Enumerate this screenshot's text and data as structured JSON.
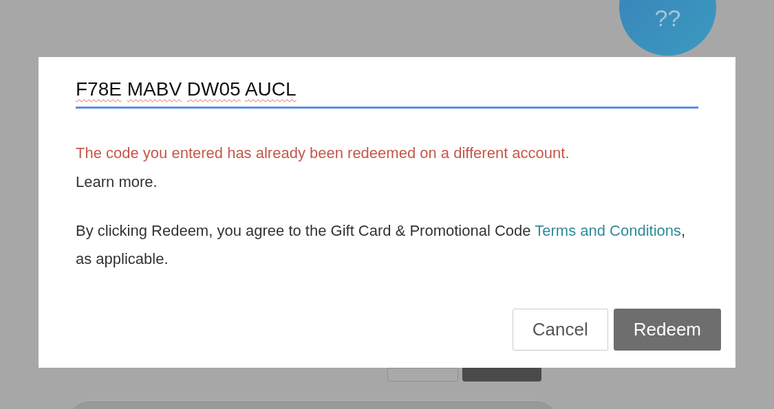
{
  "background": {
    "badge": "??"
  },
  "dialog": {
    "code_field": {
      "value": "F78E MABV DW05 AUCL",
      "focused": true,
      "spellcheck_flagged": true
    },
    "error": {
      "message": "The code you entered has already been redeemed on a different account.",
      "link": "Learn more."
    },
    "terms": {
      "before": "By clicking Redeem, you agree to the Gift Card & Promotional Code ",
      "link": "Terms and Conditions",
      "after": ", as applicable."
    },
    "buttons": [
      {
        "label": "Cancel",
        "kind": "secondary"
      },
      {
        "label": "Redeem",
        "kind": "primary"
      }
    ]
  }
}
